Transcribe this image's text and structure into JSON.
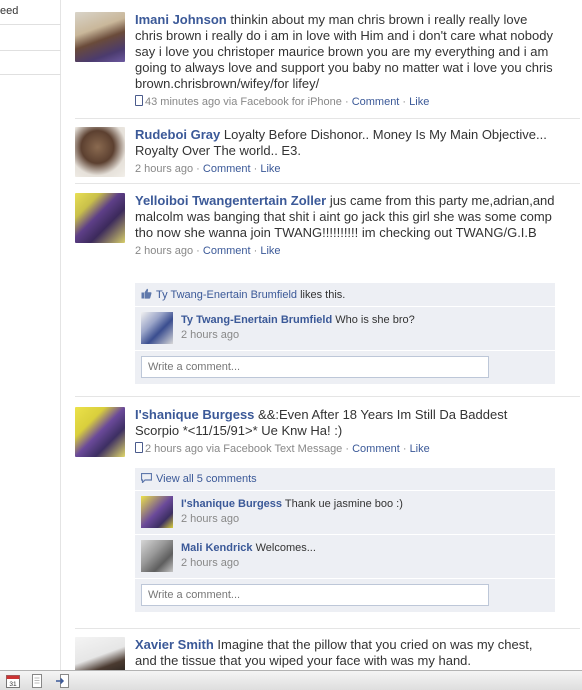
{
  "sidebar": {
    "items": [
      {
        "label": "eed"
      }
    ]
  },
  "stories": [
    {
      "actor": "Imani Johnson",
      "text": "thinkin about my man chris brown i really really love chris brown i really do i am in love with Him and i don't care what nobody say i love you christoper maurice brown you are my everything and i am going to always love and support you baby no matter wat i love you chris brown.chrisbrown/wifey/for lifey/",
      "time": "43 minutes ago via Facebook for iPhone",
      "comment_label": "Comment",
      "like_label": "Like"
    },
    {
      "actor": "Rudeboi Gray",
      "text": "Loyalty Before Dishonor.. Money Is My Main Objective... Royalty Over The world.. E3.",
      "time": "2 hours ago",
      "comment_label": "Comment",
      "like_label": "Like"
    },
    {
      "actor": "Yelloiboi Twangentertain Zoller",
      "text": "jus came from this party me,adrian,and malcolm was banging that shit i aint go jack this girl she was some comp tho now she wanna join TWANG!!!!!!!!!! im checking out TWANG/G.I.B",
      "time": "2 hours ago",
      "comment_label": "Comment",
      "like_label": "Like",
      "likes": {
        "name": "Ty Twang-Enertain Brumfield",
        "suffix": "likes this."
      },
      "comments": [
        {
          "name": "Ty Twang-Enertain Brumfield",
          "text": "Who is she bro?",
          "time": "2 hours ago"
        }
      ],
      "input_placeholder": "Write a comment..."
    },
    {
      "actor": "I'shanique Burgess",
      "text": "&&:Even After 18 Years Im Still Da Baddest Scorpio *<11/15/91>* Ue Knw Ha! :)",
      "time": "2 hours ago via Facebook Text Message",
      "comment_label": "Comment",
      "like_label": "Like",
      "view_all": "View all 5 comments",
      "comments": [
        {
          "name": "I'shanique Burgess",
          "text": "Thank ue jasmine boo :)",
          "time": "2 hours ago"
        },
        {
          "name": "Mali Kendrick",
          "text": "Welcomes...",
          "time": "2 hours ago"
        }
      ],
      "input_placeholder": "Write a comment..."
    },
    {
      "actor": "Xavier Smith",
      "text": "Imagine that the pillow that you cried on was my chest, and the tissue that you wiped your face with was my hand."
    }
  ],
  "colors": {
    "link": "#3b5998",
    "ufi_bg": "#edeff4",
    "meta": "#888888"
  },
  "bottombar": {
    "icons": [
      "calendar-icon",
      "page-icon",
      "exit-icon"
    ],
    "calendar_day": "31"
  }
}
